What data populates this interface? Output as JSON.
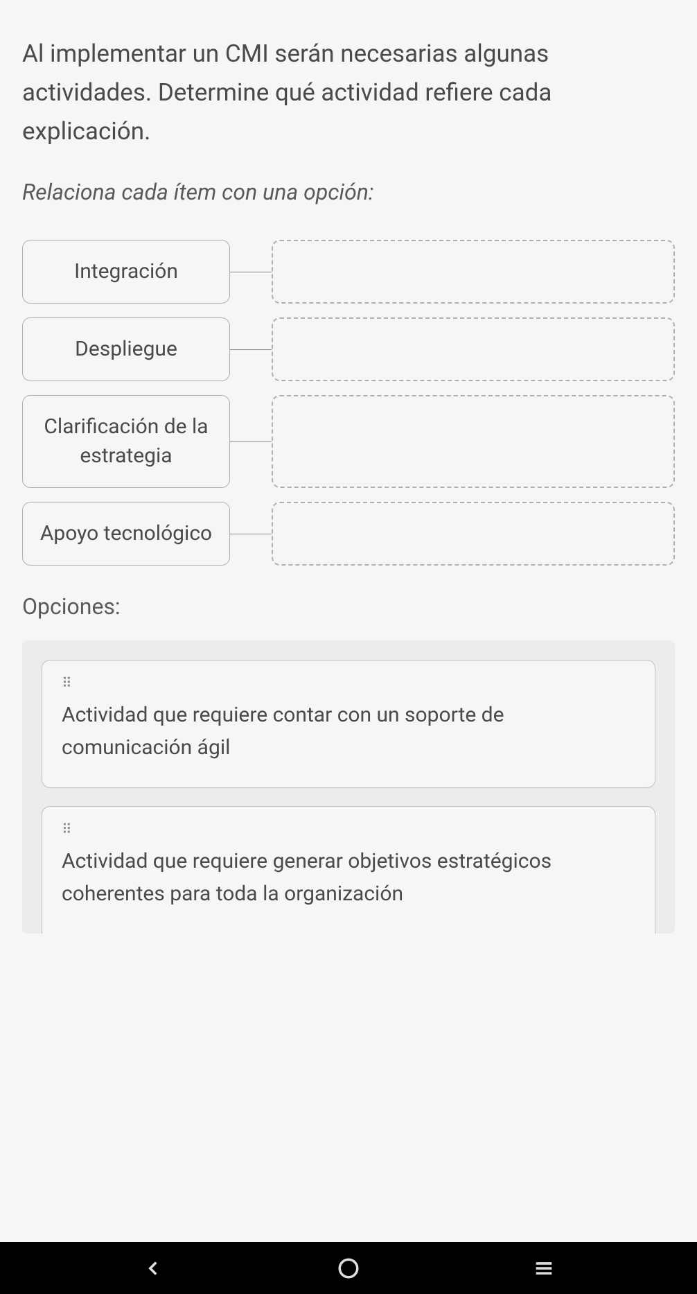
{
  "question": "Al implementar un CMI serán necesarias algunas actividades. Determine qué actividad refiere cada explicación.",
  "instruction": "Relaciona cada ítem con una opción:",
  "items": [
    {
      "label": "Integración"
    },
    {
      "label": "Despliegue"
    },
    {
      "label": "Clarificación de la estrategia"
    },
    {
      "label": "Apoyo tecnológico"
    }
  ],
  "options_label": "Opciones:",
  "options": [
    {
      "text": "Actividad que requiere contar con un soporte de comunicación ágil"
    },
    {
      "text": "Actividad que requiere generar objetivos estratégicos coherentes para toda la organización"
    }
  ]
}
